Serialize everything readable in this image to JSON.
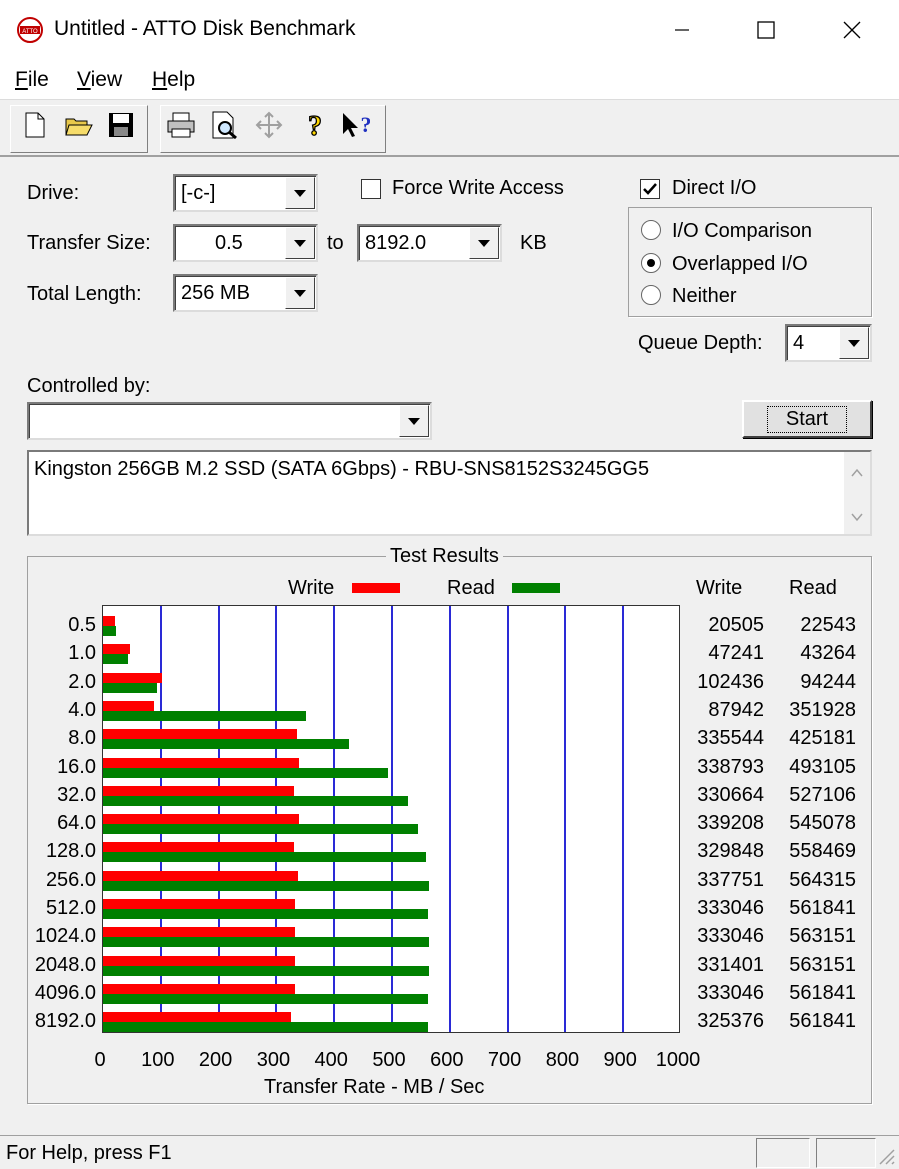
{
  "window": {
    "title": "Untitled - ATTO Disk Benchmark"
  },
  "menu": {
    "file": "File",
    "view": "View",
    "help": "Help"
  },
  "toolbar": {
    "icons": [
      "new-icon",
      "open-icon",
      "save-icon",
      "print-icon",
      "print-preview-icon",
      "move-icon",
      "help-icon",
      "context-help-icon"
    ]
  },
  "form": {
    "drive_label": "Drive:",
    "drive_value": "[-c-]",
    "transfer_size_label": "Transfer Size:",
    "transfer_from": "0.5",
    "to_label": "to",
    "transfer_to": "8192.0",
    "kb_label": "KB",
    "total_length_label": "Total Length:",
    "total_length_value": "256 MB",
    "force_write_label": "Force Write Access",
    "force_write_checked": false,
    "direct_io_label": "Direct I/O",
    "direct_io_checked": true,
    "io_comparison_label": "I/O Comparison",
    "overlapped_label": "Overlapped I/O",
    "neither_label": "Neither",
    "selected_mode": "Overlapped I/O",
    "queue_depth_label": "Queue Depth:",
    "queue_depth_value": "4",
    "controlled_by_label": "Controlled by:",
    "controlled_by_value": "",
    "start_label": "Start",
    "description": "Kingston 256GB M.2 SSD (SATA 6Gbps) - RBU-SNS8152S3245GG5"
  },
  "results": {
    "title": "Test Results",
    "write_col": "Write",
    "read_col": "Read",
    "rows": [
      {
        "size": "0.5",
        "write": "20505",
        "read": "22543"
      },
      {
        "size": "1.0",
        "write": "47241",
        "read": "43264"
      },
      {
        "size": "2.0",
        "write": "102436",
        "read": "94244"
      },
      {
        "size": "4.0",
        "write": "87942",
        "read": "351928"
      },
      {
        "size": "8.0",
        "write": "335544",
        "read": "425181"
      },
      {
        "size": "16.0",
        "write": "338793",
        "read": "493105"
      },
      {
        "size": "32.0",
        "write": "330664",
        "read": "527106"
      },
      {
        "size": "64.0",
        "write": "339208",
        "read": "545078"
      },
      {
        "size": "128.0",
        "write": "329848",
        "read": "558469"
      },
      {
        "size": "256.0",
        "write": "337751",
        "read": "564315"
      },
      {
        "size": "512.0",
        "write": "333046",
        "read": "561841"
      },
      {
        "size": "1024.0",
        "write": "333046",
        "read": "563151"
      },
      {
        "size": "2048.0",
        "write": "331401",
        "read": "563151"
      },
      {
        "size": "4096.0",
        "write": "333046",
        "read": "561841"
      },
      {
        "size": "8192.0",
        "write": "325376",
        "read": "561841"
      }
    ]
  },
  "chart_data": {
    "type": "bar",
    "orientation": "horizontal",
    "categories": [
      "0.5",
      "1.0",
      "2.0",
      "4.0",
      "8.0",
      "16.0",
      "32.0",
      "64.0",
      "128.0",
      "256.0",
      "512.0",
      "1024.0",
      "2048.0",
      "4096.0",
      "8192.0"
    ],
    "series": [
      {
        "name": "Write",
        "color": "#ff0000",
        "values": [
          20.5,
          47.2,
          102.4,
          87.9,
          335.5,
          338.8,
          330.7,
          339.2,
          329.8,
          337.8,
          333.0,
          333.0,
          331.4,
          333.0,
          325.4
        ]
      },
      {
        "name": "Read",
        "color": "#008000",
        "values": [
          22.5,
          43.3,
          94.2,
          351.9,
          425.2,
          493.1,
          527.1,
          545.1,
          558.5,
          564.3,
          561.8,
          563.2,
          563.2,
          561.8,
          561.8
        ]
      }
    ],
    "xlabel": "Transfer Rate - MB / Sec",
    "xlim": [
      0,
      1000
    ],
    "xticks": [
      "0",
      "100",
      "200",
      "300",
      "400",
      "500",
      "600",
      "700",
      "800",
      "900",
      "1000"
    ],
    "grid": true,
    "legend": "top"
  },
  "status": {
    "text": "For Help, press F1"
  }
}
